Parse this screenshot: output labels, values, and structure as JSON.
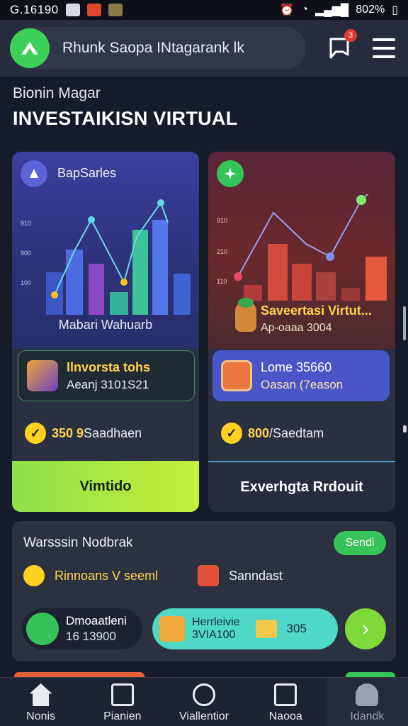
{
  "status_bar": {
    "time": "G.16190",
    "battery": "802%"
  },
  "header": {
    "app_title": "Rhunk Saopa INtagarank lk",
    "notification_count": "3"
  },
  "hero": {
    "greeting": "Bionin Magar",
    "headline": "INVESTAIKISN VIRTUAL"
  },
  "cards": [
    {
      "title": "BapSarles",
      "y_ticks": [
        "910",
        "900",
        "100"
      ],
      "caption": "Mabari Wahuarb",
      "info_title": "Ilnvorsta tohs",
      "info_sub": "Aeanj 3101S21",
      "stat_value": "350 9",
      "stat_label": "Saadhaen",
      "cta": "Vimtido",
      "accent": "#c6f03b"
    },
    {
      "title": "",
      "y_ticks": [
        "910",
        "210",
        "110"
      ],
      "caption_title": "Saveertasi Virtut...",
      "caption_sub": "Ap-oaaa 3004",
      "info_title": "Lome 35660",
      "info_sub": "Oasan (7eason",
      "stat_value": "800",
      "stat_label": "/Saedtam",
      "cta": "Exverhgta Rrdouit",
      "accent": "#36c35a"
    }
  ],
  "panel": {
    "title": "Warsssin Nodbrak",
    "send_label": "Sendi",
    "item_a": "Rinnoans V seeml",
    "item_b": "Sanndast",
    "mini_a_title": "Dmoaatleni",
    "mini_a_sub": "16 13900",
    "mini_b_title": "Herrleivie",
    "mini_b_sub": "3VIA100",
    "mini_b_amount": "305"
  },
  "bottom_nav": [
    "Nonis",
    "Pianien",
    "Viallentior",
    "Naooa",
    "Idandk"
  ]
}
